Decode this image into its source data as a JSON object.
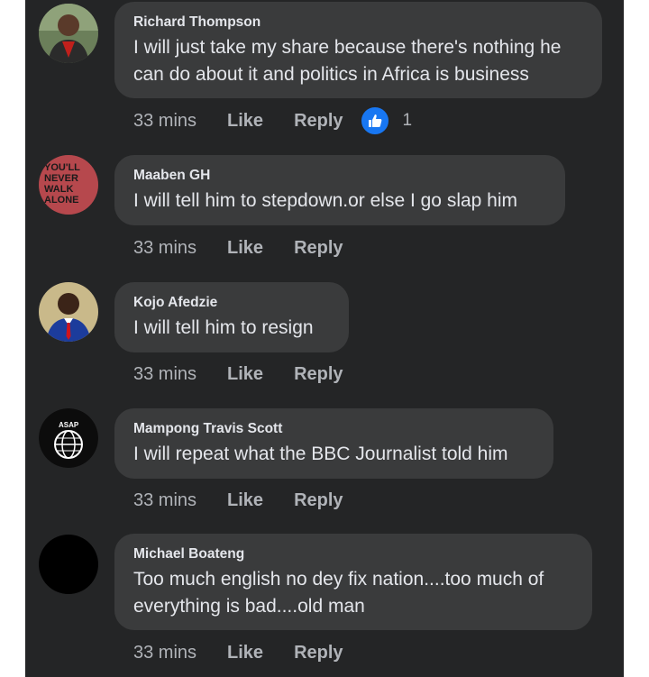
{
  "comments": [
    {
      "author": "Richard Thompson",
      "lines": [
        "I will just take my share because there's nothing he",
        "can do about it and politics in Africa is business"
      ],
      "time": "33 mins",
      "like_label": "Like",
      "reply_label": "Reply",
      "reaction": {
        "icon": "thumbs-up-icon",
        "count": "1"
      }
    },
    {
      "author": "Maaben GH",
      "lines": [
        "I will tell him to stepdown.or else I go slap him"
      ],
      "time": "33 mins",
      "like_label": "Like",
      "reply_label": "Reply",
      "avatar_text": [
        "YOU'LL",
        "NEVER",
        "WALK",
        "ALONE"
      ]
    },
    {
      "author": "Kojo Afedzie",
      "lines": [
        "I will tell him to resign"
      ],
      "time": "33 mins",
      "like_label": "Like",
      "reply_label": "Reply"
    },
    {
      "author": "Mampong Travis Scott",
      "lines": [
        "I will repeat what the BBC Journalist told him"
      ],
      "time": "33 mins",
      "like_label": "Like",
      "reply_label": "Reply",
      "avatar_text": [
        "ASAP"
      ]
    },
    {
      "author": "Michael Boateng",
      "lines": [
        "Too much english no dey fix nation....too much of",
        "everything is bad....old man"
      ],
      "time": "33 mins",
      "like_label": "Like",
      "reply_label": "Reply"
    }
  ],
  "colors": {
    "background": "#242526",
    "bubble": "#3a3b3c",
    "text": "#e4e6eb",
    "secondary_text": "#b0b3b8",
    "reaction_blue": "#1877f2"
  }
}
